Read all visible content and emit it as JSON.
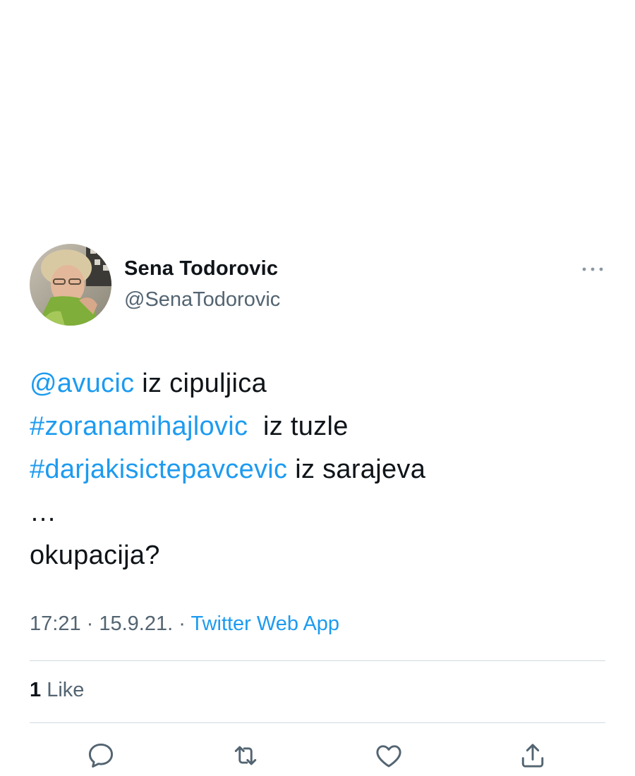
{
  "author": {
    "name": "Sena Todorovic",
    "handle": "@SenaTodorovic",
    "avatar_icon": "profile-photo"
  },
  "tweet": {
    "lines": [
      {
        "link": "@avucic",
        "text": " iz cipuljica"
      },
      {
        "link": "#zoranamihajlovic",
        "text": "  iz tuzle"
      },
      {
        "link": "#darjakisictepavcevic",
        "text": " iz sarajeva"
      },
      {
        "link": "",
        "text": "…"
      },
      {
        "link": "",
        "text": "okupacija?"
      }
    ]
  },
  "meta": {
    "time": "17:21",
    "separator": " · ",
    "date": "15.9.21.",
    "separator2": " · ",
    "source": "Twitter Web App"
  },
  "stats": {
    "like_count": "1",
    "like_label": " Like"
  },
  "actions": [
    {
      "name": "reply",
      "icon": "reply-icon"
    },
    {
      "name": "retweet",
      "icon": "retweet-icon"
    },
    {
      "name": "like",
      "icon": "heart-icon"
    },
    {
      "name": "share",
      "icon": "share-icon"
    }
  ],
  "colors": {
    "link": "#1d9bf0",
    "secondary_text": "#536471",
    "primary_text": "#0f1419",
    "divider": "#cfd9de"
  }
}
